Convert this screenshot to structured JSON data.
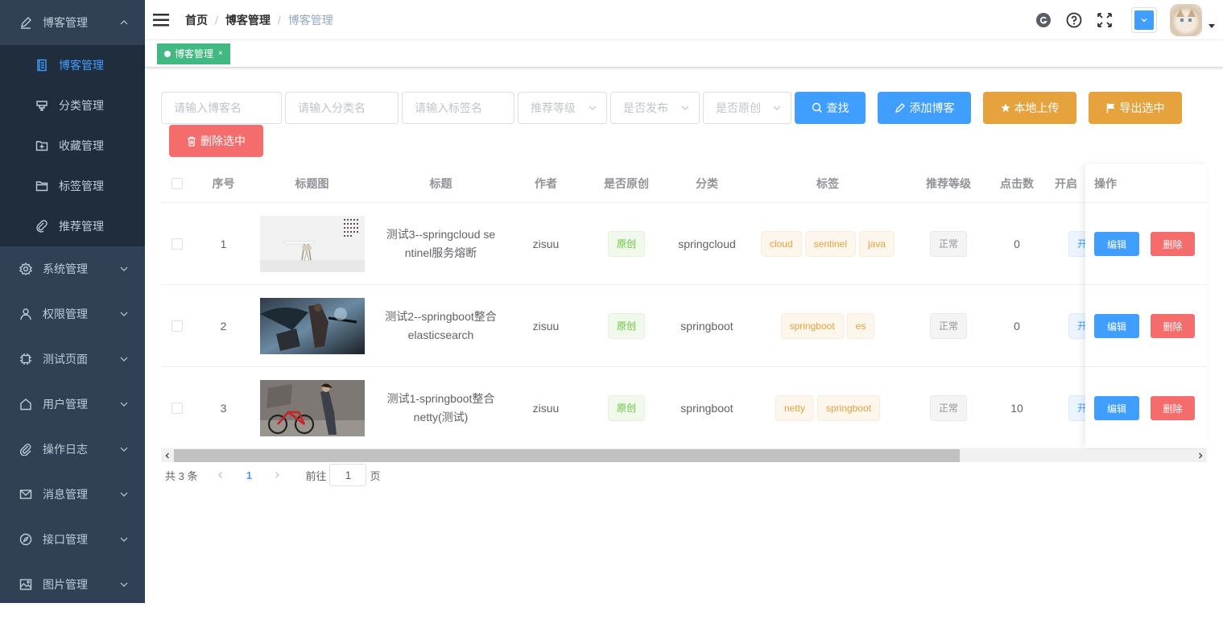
{
  "sidebar": {
    "parent_open": {
      "label": "博客管理",
      "icon": "edit-icon"
    },
    "sub_items": [
      {
        "label": "博客管理",
        "icon": "document-icon",
        "active": true
      },
      {
        "label": "分类管理",
        "icon": "category-icon"
      },
      {
        "label": "收藏管理",
        "icon": "folder-add-icon"
      },
      {
        "label": "标签管理",
        "icon": "folder-icon"
      },
      {
        "label": "推荐管理",
        "icon": "paperclip-icon"
      }
    ],
    "items": [
      {
        "label": "系统管理",
        "icon": "gear-icon"
      },
      {
        "label": "权限管理",
        "icon": "user-icon"
      },
      {
        "label": "测试页面",
        "icon": "cpu-icon"
      },
      {
        "label": "用户管理",
        "icon": "home-icon"
      },
      {
        "label": "操作日志",
        "icon": "attachment-icon"
      },
      {
        "label": "消息管理",
        "icon": "message-icon"
      },
      {
        "label": "接口管理",
        "icon": "compass-icon"
      },
      {
        "label": "图片管理",
        "icon": "picture-icon"
      }
    ]
  },
  "header": {
    "breadcrumb": [
      "首页",
      "博客管理",
      "博客管理"
    ]
  },
  "tags_view": {
    "active_tag": "博客管理",
    "close": "×"
  },
  "filters": {
    "blog_name_placeholder": "请输入博客名",
    "category_placeholder": "请输入分类名",
    "tag_placeholder": "请输入标签名",
    "level_placeholder": "推荐等级",
    "publish_placeholder": "是否发布",
    "original_placeholder": "是否原创",
    "search_label": "查找",
    "add_label": "添加博客",
    "upload_label": "本地上传",
    "export_label": "导出选中",
    "delete_label": "删除选中"
  },
  "table": {
    "columns": [
      "序号",
      "标题图",
      "标题",
      "作者",
      "是否原创",
      "分类",
      "标签",
      "推荐等级",
      "点击数",
      "开启",
      "操作"
    ],
    "rows": [
      {
        "index": "1",
        "title": "测试3--springcloud sentinel服务熔断",
        "author": "zisuu",
        "original": "原创",
        "category": "springcloud",
        "tags": [
          "cloud",
          "sentinel",
          "java"
        ],
        "level": "正常",
        "clicks": "0",
        "open": "开"
      },
      {
        "index": "2",
        "title": "测试2--springboot整合elasticsearch",
        "author": "zisuu",
        "original": "原创",
        "category": "springboot",
        "tags": [
          "springboot",
          "es"
        ],
        "level": "正常",
        "clicks": "0",
        "open": "开"
      },
      {
        "index": "3",
        "title": "测试1-springboot整合netty(测试)",
        "author": "zisuu",
        "original": "原创",
        "category": "springboot",
        "tags": [
          "netty",
          "springboot"
        ],
        "level": "正常",
        "clicks": "10",
        "open": "开"
      }
    ],
    "edit_label": "编辑",
    "delete_label": "删除"
  },
  "pagination": {
    "total": "共 3 条",
    "current": "1",
    "goto_prefix": "前往",
    "goto_value": "1",
    "goto_suffix": "页"
  },
  "colors": {
    "sidebar_bg": "#304156",
    "primary": "#409eff",
    "warning": "#e6a23c",
    "danger": "#f56c6c",
    "success": "#42b983"
  }
}
